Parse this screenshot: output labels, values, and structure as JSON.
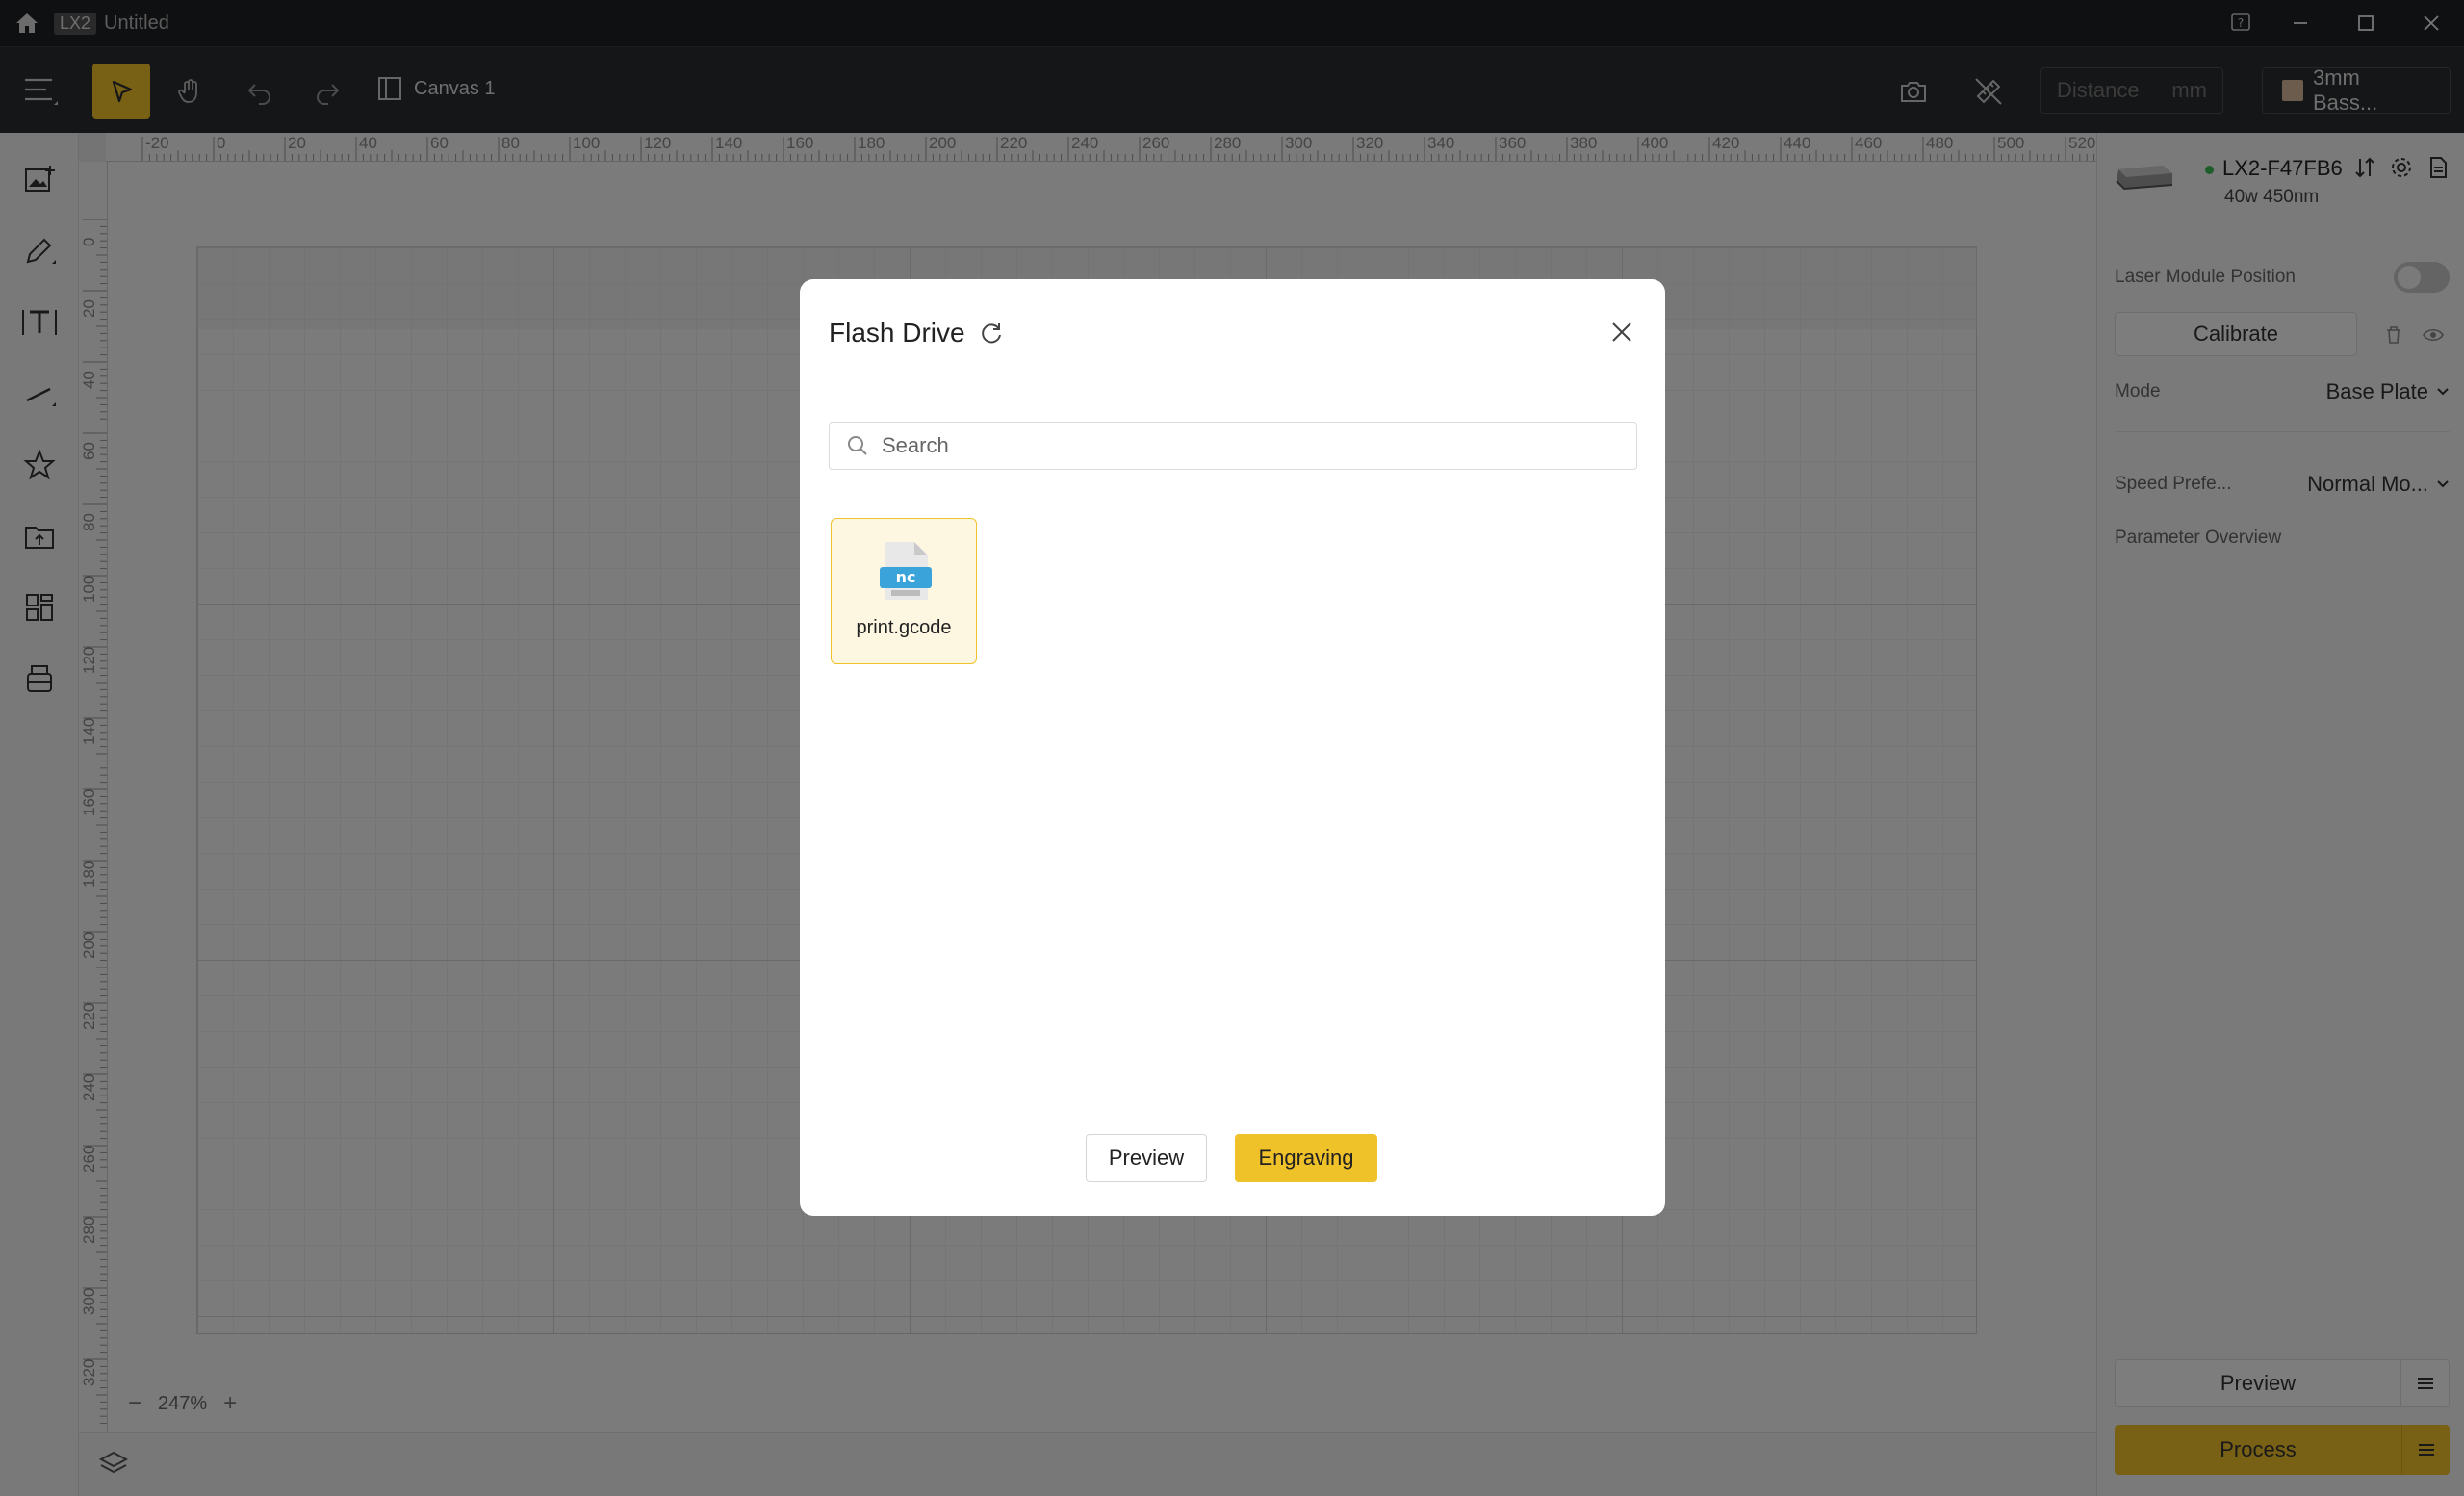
{
  "titlebar": {
    "brand_badge": "LX2",
    "doc_title": "Untitled"
  },
  "toolbar": {
    "canvas_label": "Canvas 1",
    "distance_placeholder": "Distance",
    "distance_unit": "mm",
    "material_label": "3mm Bass..."
  },
  "ruler": {
    "top_ticks": [
      "-20",
      "0",
      "20",
      "40",
      "60",
      "80",
      "100",
      "120",
      "140",
      "160",
      "180",
      "200",
      "220",
      "240",
      "260",
      "280",
      "300",
      "320",
      "340",
      "360",
      "380",
      "400",
      "420",
      "440",
      "460",
      "480",
      "500",
      "520"
    ],
    "left_ticks": [
      "0",
      "20",
      "40",
      "60",
      "80",
      "100",
      "120",
      "140",
      "160",
      "180",
      "200",
      "220",
      "240",
      "260",
      "280",
      "300",
      "320"
    ]
  },
  "canvas": {
    "zoom": "247%"
  },
  "right_panel": {
    "device_name": "LX2-F47FB6",
    "device_spec": "40w 450nm",
    "laser_module_position": "Laser Module Position",
    "calibrate": "Calibrate",
    "mode_label": "Mode",
    "mode_value": "Base Plate",
    "speed_label": "Speed Prefe...",
    "speed_value": "Normal Mo...",
    "parameter_overview": "Parameter Overview",
    "preview": "Preview",
    "process": "Process"
  },
  "modal": {
    "title": "Flash Drive",
    "search_placeholder": "Search",
    "files": [
      {
        "name": "print.gcode",
        "icon_text": "nc"
      }
    ],
    "preview_button": "Preview",
    "engraving_button": "Engraving"
  },
  "colors": {
    "accent": "#f0c22a",
    "titlebar": "#1f2022",
    "toolbar": "#2b2c2f",
    "status_online": "#3cba54"
  }
}
